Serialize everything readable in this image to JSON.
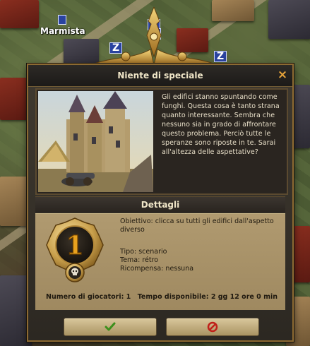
{
  "world": {
    "player_name": "Marmista",
    "sleep_badges": [
      "Z",
      "Z",
      "Z",
      "Z"
    ]
  },
  "dialog": {
    "title": "Niente di speciale",
    "close_label": "×",
    "story": "Gli edifici stanno spuntando come funghi. Questa cosa è tanto strana quanto interessante. Sembra che nessuno sia in grado di affrontare questo problema. Perciò tutte le speranze sono riposte in te. Sarai all'altezza delle aspettative?",
    "details_title": "Dettagli",
    "medal_number": "1",
    "objective": "Obiettivo: clicca su tutti gli edifici dall'aspetto diverso",
    "type": "Tipo: scenario",
    "theme": "Tema: rétro",
    "reward": "Ricompensa: nessuna",
    "players": "Numero di giocatori: 1",
    "time": "Tempo disponibile: 2 gg 12 ore 0 min"
  },
  "buttons": {
    "accept_icon": "checkmark-icon",
    "decline_icon": "prohibited-icon"
  },
  "colors": {
    "gold": "#c9a04c",
    "accept_green": "#3c8f1c",
    "decline_red": "#c0201a"
  }
}
